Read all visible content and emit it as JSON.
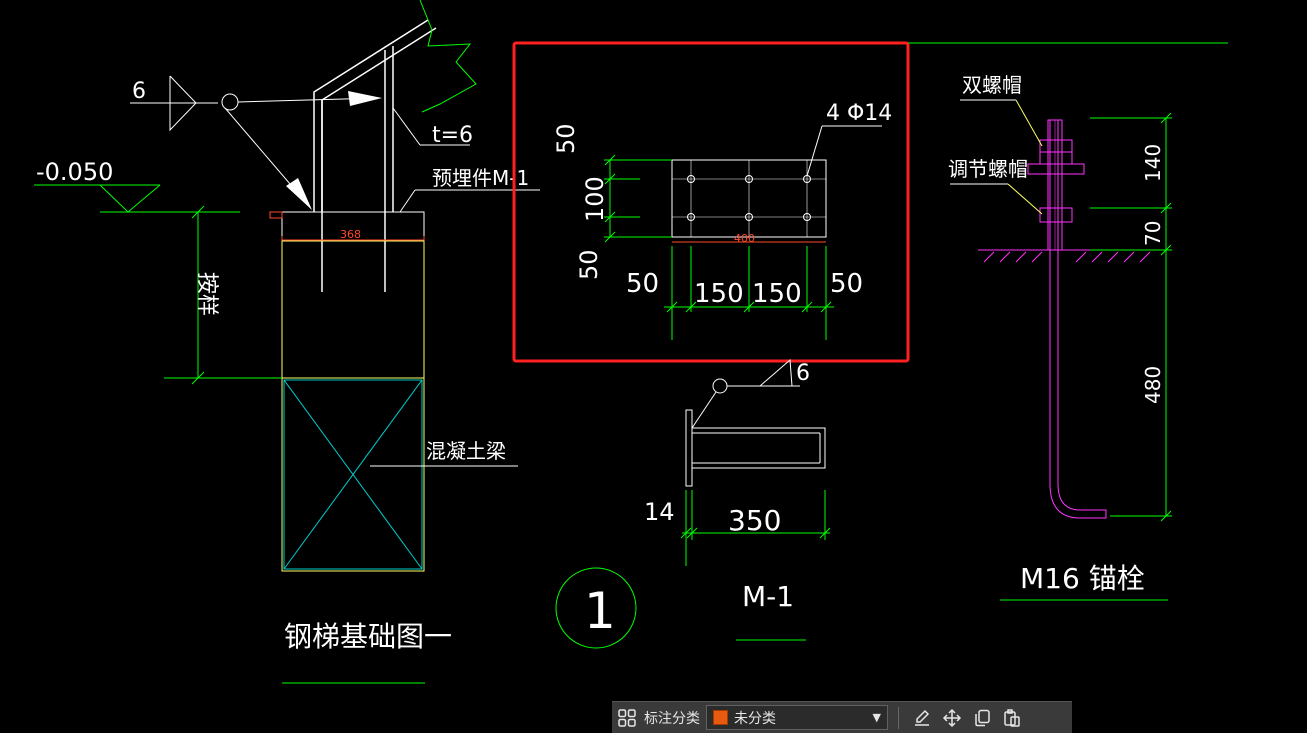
{
  "colors": {
    "background": "#000000",
    "line_white": "#ffffff",
    "line_green": "#00ff00",
    "line_yellow": "#ffff66",
    "line_cyan": "#00cccc",
    "line_magenta": "#ff33ff",
    "dim_red": "#ff4a2a",
    "highlight_frame": "#ff2020",
    "category_swatch": "#e85a10"
  },
  "drawing": {
    "top_labels": {
      "pre_embed": "预埋件M-1",
      "thickness": "t=6",
      "weld": "6"
    },
    "elevation": "-0.050",
    "base_plate_width": "368",
    "height_label": "按样",
    "beam_label": "混凝土梁",
    "foundation_title": "钢梯基础图一",
    "detail_number": "1",
    "plate": {
      "bolt_spec": "4 Φ14",
      "v_dims": [
        "50",
        "100",
        "50"
      ],
      "width_dim": "400",
      "h_dims": [
        "50",
        "150",
        "150",
        "50"
      ]
    },
    "section": {
      "weld": "6",
      "thickness": "14",
      "length": "350",
      "title": "M-1"
    },
    "anchor": {
      "double_nut": "双螺帽",
      "adjust_nut": "调节螺帽",
      "dims": [
        "140",
        "70",
        "480"
      ],
      "title": "M16 锚栓"
    }
  },
  "toolbar": {
    "label": "标注分类",
    "select_value": "未分类",
    "icons": [
      "layout-grid-icon",
      "chevron-down-icon",
      "edit-icon",
      "move-icon",
      "copy-icon",
      "paste-icon"
    ]
  }
}
